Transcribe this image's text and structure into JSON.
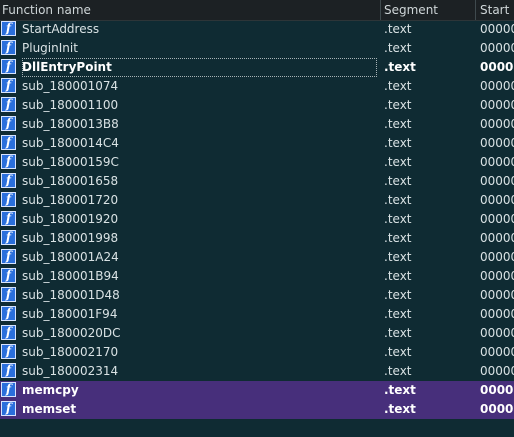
{
  "columns": {
    "name": "Function name",
    "segment": "Segment",
    "start": "Start"
  },
  "rows": [
    {
      "name": "StartAddress",
      "segment": ".text",
      "start": "00000",
      "bold": false,
      "library": false,
      "selected": false
    },
    {
      "name": "PluginInit",
      "segment": ".text",
      "start": "00000",
      "bold": false,
      "library": false,
      "selected": false
    },
    {
      "name": "DllEntryPoint",
      "segment": ".text",
      "start": "0000",
      "bold": true,
      "library": false,
      "selected": true
    },
    {
      "name": "sub_180001074",
      "segment": ".text",
      "start": "00000",
      "bold": false,
      "library": false,
      "selected": false
    },
    {
      "name": "sub_180001100",
      "segment": ".text",
      "start": "00000",
      "bold": false,
      "library": false,
      "selected": false
    },
    {
      "name": "sub_1800013B8",
      "segment": ".text",
      "start": "00000",
      "bold": false,
      "library": false,
      "selected": false
    },
    {
      "name": "sub_1800014C4",
      "segment": ".text",
      "start": "00000",
      "bold": false,
      "library": false,
      "selected": false
    },
    {
      "name": "sub_18000159C",
      "segment": ".text",
      "start": "00000",
      "bold": false,
      "library": false,
      "selected": false
    },
    {
      "name": "sub_180001658",
      "segment": ".text",
      "start": "00000",
      "bold": false,
      "library": false,
      "selected": false
    },
    {
      "name": "sub_180001720",
      "segment": ".text",
      "start": "00000",
      "bold": false,
      "library": false,
      "selected": false
    },
    {
      "name": "sub_180001920",
      "segment": ".text",
      "start": "00000",
      "bold": false,
      "library": false,
      "selected": false
    },
    {
      "name": "sub_180001998",
      "segment": ".text",
      "start": "00000",
      "bold": false,
      "library": false,
      "selected": false
    },
    {
      "name": "sub_180001A24",
      "segment": ".text",
      "start": "00000",
      "bold": false,
      "library": false,
      "selected": false
    },
    {
      "name": "sub_180001B94",
      "segment": ".text",
      "start": "00000",
      "bold": false,
      "library": false,
      "selected": false
    },
    {
      "name": "sub_180001D48",
      "segment": ".text",
      "start": "00000",
      "bold": false,
      "library": false,
      "selected": false
    },
    {
      "name": "sub_180001F94",
      "segment": ".text",
      "start": "00000",
      "bold": false,
      "library": false,
      "selected": false
    },
    {
      "name": "sub_1800020DC",
      "segment": ".text",
      "start": "00000",
      "bold": false,
      "library": false,
      "selected": false
    },
    {
      "name": "sub_180002170",
      "segment": ".text",
      "start": "00000",
      "bold": false,
      "library": false,
      "selected": false
    },
    {
      "name": "sub_180002314",
      "segment": ".text",
      "start": "00000",
      "bold": false,
      "library": false,
      "selected": false
    },
    {
      "name": "memcpy",
      "segment": ".text",
      "start": "0000",
      "bold": true,
      "library": true,
      "selected": false
    },
    {
      "name": "memset",
      "segment": ".text",
      "start": "0000",
      "bold": true,
      "library": true,
      "selected": false
    }
  ],
  "function_icon": {
    "glyph": "f",
    "name": "function-icon"
  },
  "colors": {
    "background": "#0f2b33",
    "header": "#1c2124",
    "library_row": "#472f7b",
    "icon": "#2a6fdc"
  }
}
